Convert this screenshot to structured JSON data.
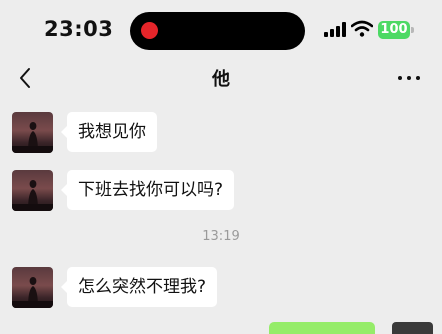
{
  "status_bar": {
    "time": "23:03",
    "battery": "100",
    "recording_color": "#e5252a",
    "battery_color": "#4cd964",
    "icons": [
      "signal-icon",
      "wifi-icon",
      "battery-icon"
    ]
  },
  "nav": {
    "title": "他",
    "icons": [
      "back-chevron-icon",
      "more-options-icon"
    ]
  },
  "messages": [
    {
      "text": "我想见你"
    },
    {
      "text": "下班去找你可以吗?"
    },
    {
      "text": "怎么突然不理我?"
    }
  ],
  "timestamp": "13:19",
  "colors": {
    "background": "#ededed",
    "received_bubble": "#ffffff",
    "sent_bubble": "#95ec69"
  }
}
